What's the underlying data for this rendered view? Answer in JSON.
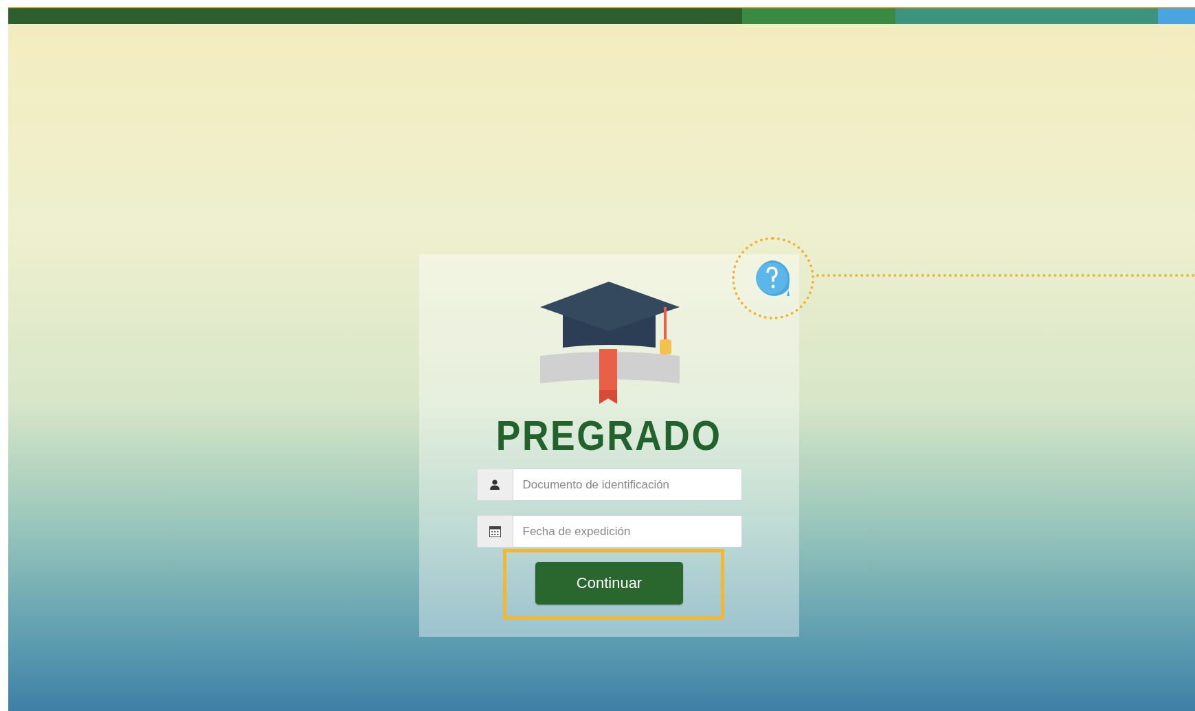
{
  "login": {
    "title": "PREGRADO",
    "fields": [
      {
        "kind": "user",
        "placeholder": "Documento de identificación"
      },
      {
        "kind": "calendar",
        "placeholder": "Fecha de expedición"
      }
    ],
    "button": "Continuar"
  }
}
